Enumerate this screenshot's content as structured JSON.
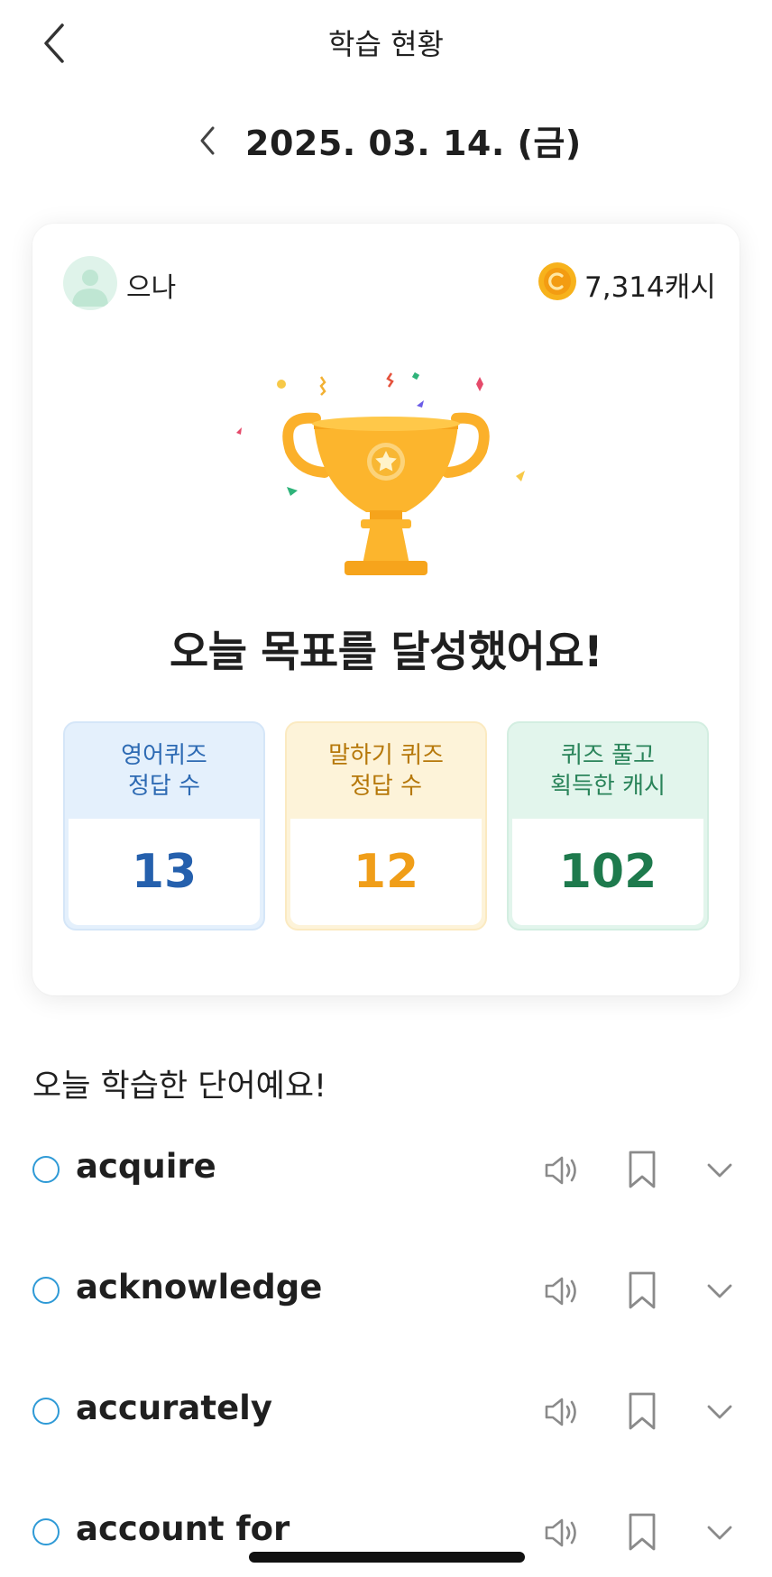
{
  "header": {
    "title": "학습 현황"
  },
  "date": {
    "text": "2025. 03. 14. (금)"
  },
  "profile": {
    "name": "으나",
    "cash": "7,314캐시"
  },
  "goal_message": "오늘 목표를 달성했어요!",
  "stats": [
    {
      "line1": "영어퀴즈",
      "line2": "정답 수",
      "value": "13",
      "color": "#2560ad"
    },
    {
      "line1": "말하기 퀴즈",
      "line2": "정답 수",
      "value": "12",
      "color": "#f09e19"
    },
    {
      "line1": "퀴즈 풀고",
      "line2": "획득한 캐시",
      "value": "102",
      "color": "#1e7a4d"
    }
  ],
  "words_section": {
    "title": "오늘 학습한 단어예요!",
    "words": [
      "acquire",
      "acknowledge",
      "accurately",
      "account for"
    ]
  },
  "icons": {
    "back": "chevron-left-icon",
    "date_prev": "chevron-left-icon",
    "coin": "coin-c-icon",
    "speaker": "speaker-icon",
    "bookmark": "bookmark-icon",
    "expand": "chevron-down-icon"
  },
  "colors": {
    "accent_blue": "#2f9ad6",
    "trophy": "#fbb02a"
  }
}
